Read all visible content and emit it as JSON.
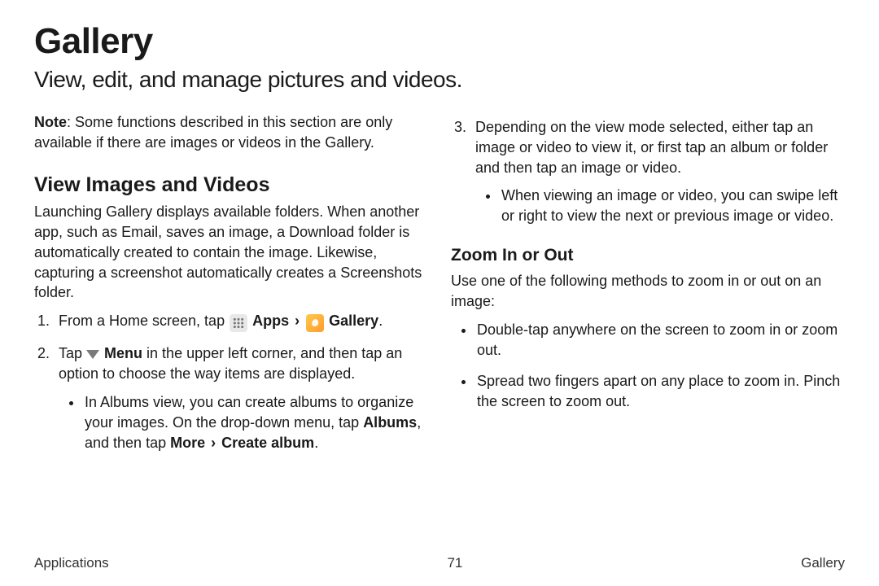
{
  "page": {
    "title": "Gallery",
    "subtitle": "View, edit, and manage pictures and videos."
  },
  "note": {
    "label": "Note",
    "text": ": Some functions described in this section are only available if there are images or videos in the Gallery."
  },
  "section_view": {
    "heading": "View Images and Videos",
    "intro": "Launching Gallery displays available folders. When another app, such as Email, saves an image, a Download folder is automatically created to contain the image. Likewise, capturing a screenshot automatically creates a Screenshots folder."
  },
  "step1": {
    "prefix": "From a Home screen, tap ",
    "apps_label": "Apps",
    "sep1": "›",
    "gallery_label": "Gallery",
    "suffix": "."
  },
  "step2": {
    "prefix": "Tap ",
    "menu_label": "Menu",
    "suffix": " in the upper left corner, and then tap an option to choose the way items are displayed."
  },
  "step2_bullet": {
    "prefix": "In Albums view, you can create albums to organize your images. On the drop-down menu, tap ",
    "albums": "Albums",
    "mid": ", and then tap ",
    "more": "More",
    "sep": "›",
    "create": "Create album",
    "suffix": "."
  },
  "step3": "Depending on the view mode selected, either tap an image or video to view it, or first tap an album or folder and then tap an image or video.",
  "step3_bullet": "When viewing an image or video, you can swipe left or right to view the next or previous image or video.",
  "section_zoom": {
    "heading": "Zoom In or Out",
    "intro": "Use one of the following methods to zoom in or out on an image:",
    "b1": "Double-tap anywhere on the screen to zoom in or zoom out.",
    "b2": "Spread two fingers apart on any place to zoom in. Pinch the screen to zoom out."
  },
  "footer": {
    "left": "Applications",
    "center": "71",
    "right": "Gallery"
  }
}
